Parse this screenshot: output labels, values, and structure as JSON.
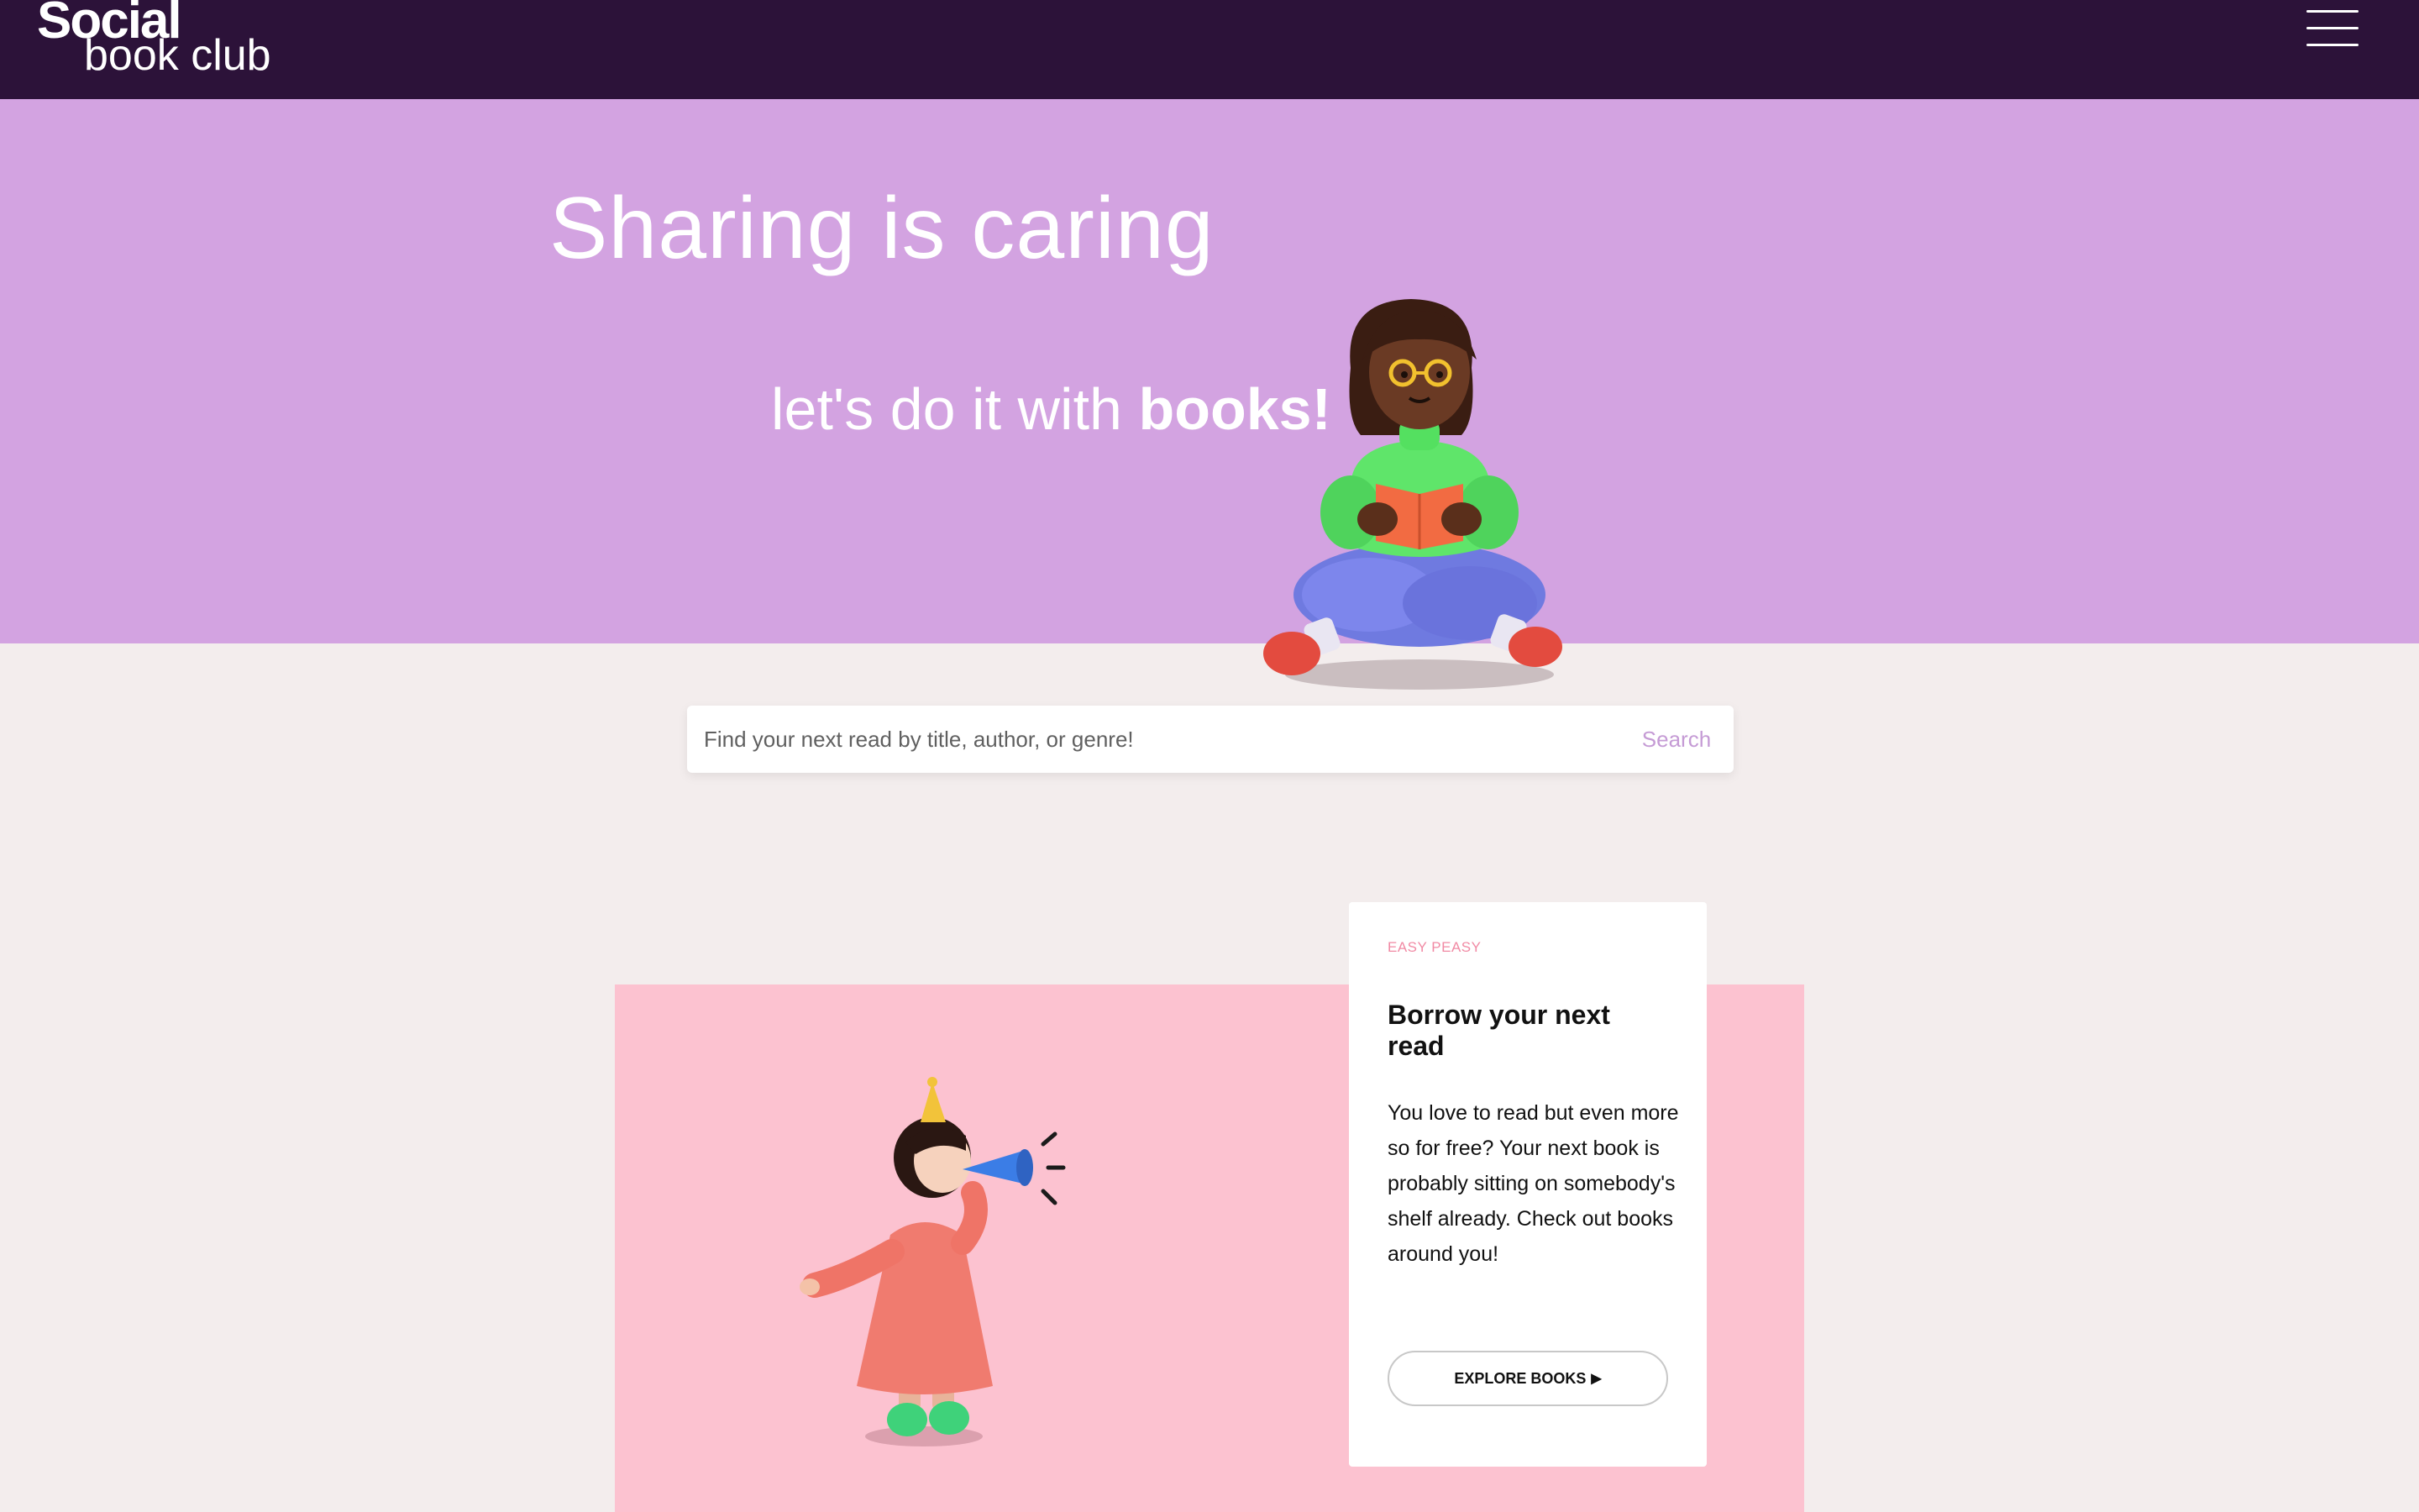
{
  "header": {
    "logo_top": "Social",
    "logo_bottom": "book club",
    "menu_icon": "hamburger-menu-icon"
  },
  "hero": {
    "title": "Sharing is caring",
    "subtitle_prefix": "let's do it with ",
    "subtitle_bold": "books!",
    "illustration": "person-reading-book"
  },
  "search": {
    "placeholder": "Find your next read by title, author, or genre!",
    "button_label": "Search"
  },
  "feature": {
    "eyebrow": "EASY PEASY",
    "title": "Borrow your next read",
    "body": "You love to read but even more so for free? Your next book is probably sitting on somebody's shelf already. Check out books around you!",
    "cta_label": "EXPLORE BOOKS",
    "cta_icon": "play-arrow-icon",
    "illustration": "girl-with-party-horn"
  },
  "colors": {
    "header_bg": "#2c1239",
    "hero_bg": "#d3a3e1",
    "page_bg": "#f3eded",
    "feature_bg": "#fcc2d0",
    "accent": "#c59bd5",
    "eyebrow": "#f18aa4"
  }
}
